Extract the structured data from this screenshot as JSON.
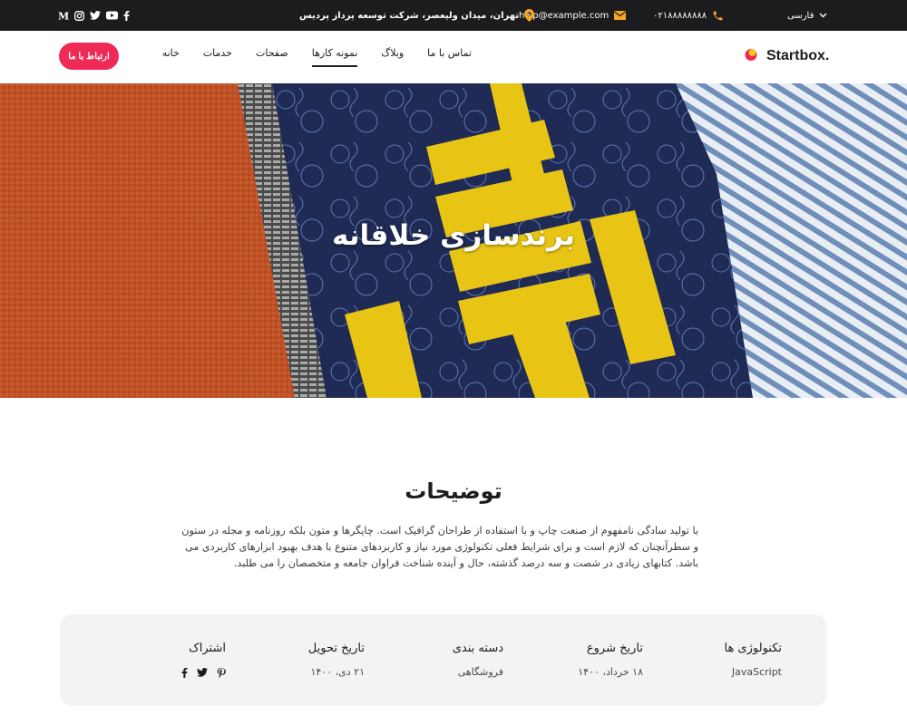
{
  "topbar": {
    "language": "فارسی",
    "phone": "۰۲۱۸۸۸۸۸۸۸۸",
    "email": "help@example.com",
    "address": "تهران، میدان ولیعصر، شرکت توسعه پرداز پردیس",
    "socials": [
      "facebook-icon",
      "youtube-icon",
      "twitter-icon",
      "instagram-icon",
      "medium-icon"
    ],
    "icon_color": "#f5a623"
  },
  "header": {
    "brand": "Startbox.",
    "nav": [
      "خانه",
      "خدمات",
      "صفحات",
      "نمونه کارها",
      "وبلاگ",
      "تماس با ما"
    ],
    "active_nav": "نمونه کارها",
    "cta": "ارتباط با ما",
    "cta_color": "#ee2a55"
  },
  "hero": {
    "title": "برندسازی خلاقانه",
    "image_text": "BEY GO"
  },
  "description": {
    "title": "توضیحات",
    "body": "با تولید سادگی نامفهوم از صنعت چاپ و با استفاده از طراحان گرافیک است. چاپگرها و متون بلکه روزنامه و مجله در ستون و سطرآنچنان که لازم است و برای شرایط فعلی تکنولوژی مورد نیاز و کاربردهای متنوع با هدف بهبود ابزارهای کاربردی می باشد. کتابهای زیادی در شصت و سه درصد گذشته، حال و آینده شناخت فراوان جامعه و متخصصان را می طلبد."
  },
  "info": {
    "technologies": {
      "label": "تکنولوژی ها",
      "value": "JavaScript"
    },
    "start_date": {
      "label": "تاریخ شروع",
      "value": "۱۸ خرداد، ۱۴۰۰"
    },
    "category": {
      "label": "دسته بندی",
      "value": "فروشگاهی"
    },
    "delivery_date": {
      "label": "تاریخ تحویل",
      "value": "۲۱ دی، ۱۴۰۰"
    },
    "share": {
      "label": "اشتراک",
      "icons": [
        "facebook-icon",
        "twitter-icon",
        "pinterest-icon"
      ]
    }
  }
}
